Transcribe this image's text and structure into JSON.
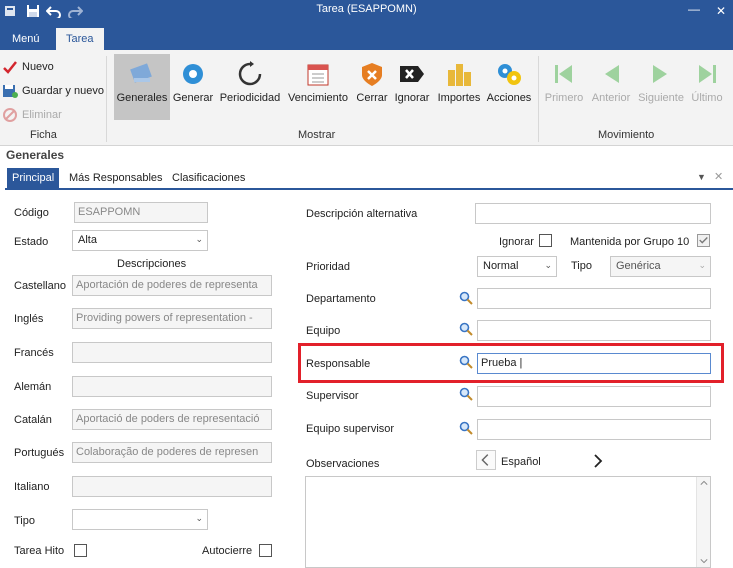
{
  "window": {
    "title": "Tarea (ESAPPOMN)"
  },
  "ribbon_tabs": {
    "menu": "Menú",
    "task": "Tarea"
  },
  "ficha": {
    "new": "Nuevo",
    "save_new": "Guardar y nuevo",
    "delete": "Eliminar",
    "label": "Ficha"
  },
  "mostrar": {
    "label": "Mostrar",
    "buttons": [
      "Generales",
      "Generar",
      "Periodicidad",
      "Vencimiento",
      "Cerrar",
      "Ignorar",
      "Importes",
      "Acciones"
    ]
  },
  "movimiento": {
    "label": "Movimiento",
    "buttons": [
      "Primero",
      "Anterior",
      "Siguiente",
      "Último"
    ]
  },
  "section_title": "Generales",
  "content_tabs": [
    "Principal",
    "Más Responsables",
    "Clasificaciones"
  ],
  "left_form": {
    "codigo_label": "Código",
    "codigo_value": "ESAPPOMN",
    "estado_label": "Estado",
    "estado_value": "Alta",
    "descripciones_label": "Descripciones",
    "langs": [
      {
        "label": "Castellano",
        "value": "Aportación de poderes de representa"
      },
      {
        "label": "Inglés",
        "value": "Providing powers of representation -"
      },
      {
        "label": "Francés",
        "value": ""
      },
      {
        "label": "Alemán",
        "value": ""
      },
      {
        "label": "Catalán",
        "value": "Aportació de poders de representació"
      },
      {
        "label": "Portugués",
        "value": "Colaboração de poderes de represen"
      },
      {
        "label": "Italiano",
        "value": ""
      }
    ],
    "tipo_label": "Tipo",
    "tarea_hito_label": "Tarea Hito",
    "autocierre_label": "Autocierre"
  },
  "right_form": {
    "desc_alt_label": "Descripción alternativa",
    "ignorar_label": "Ignorar",
    "mantenida_label": "Mantenida por Grupo 10",
    "prioridad_label": "Prioridad",
    "prioridad_value": "Normal",
    "tipo_label": "Tipo",
    "tipo_value": "Genérica",
    "departamento_label": "Departamento",
    "equipo_label": "Equipo",
    "responsable_label": "Responsable",
    "responsable_value": "Prueba |",
    "supervisor_label": "Supervisor",
    "equipo_supervisor_label": "Equipo supervisor",
    "observaciones_label": "Observaciones",
    "language": "Español"
  },
  "colors": {
    "accent": "#2b579a",
    "highlight": "#e2202a"
  }
}
